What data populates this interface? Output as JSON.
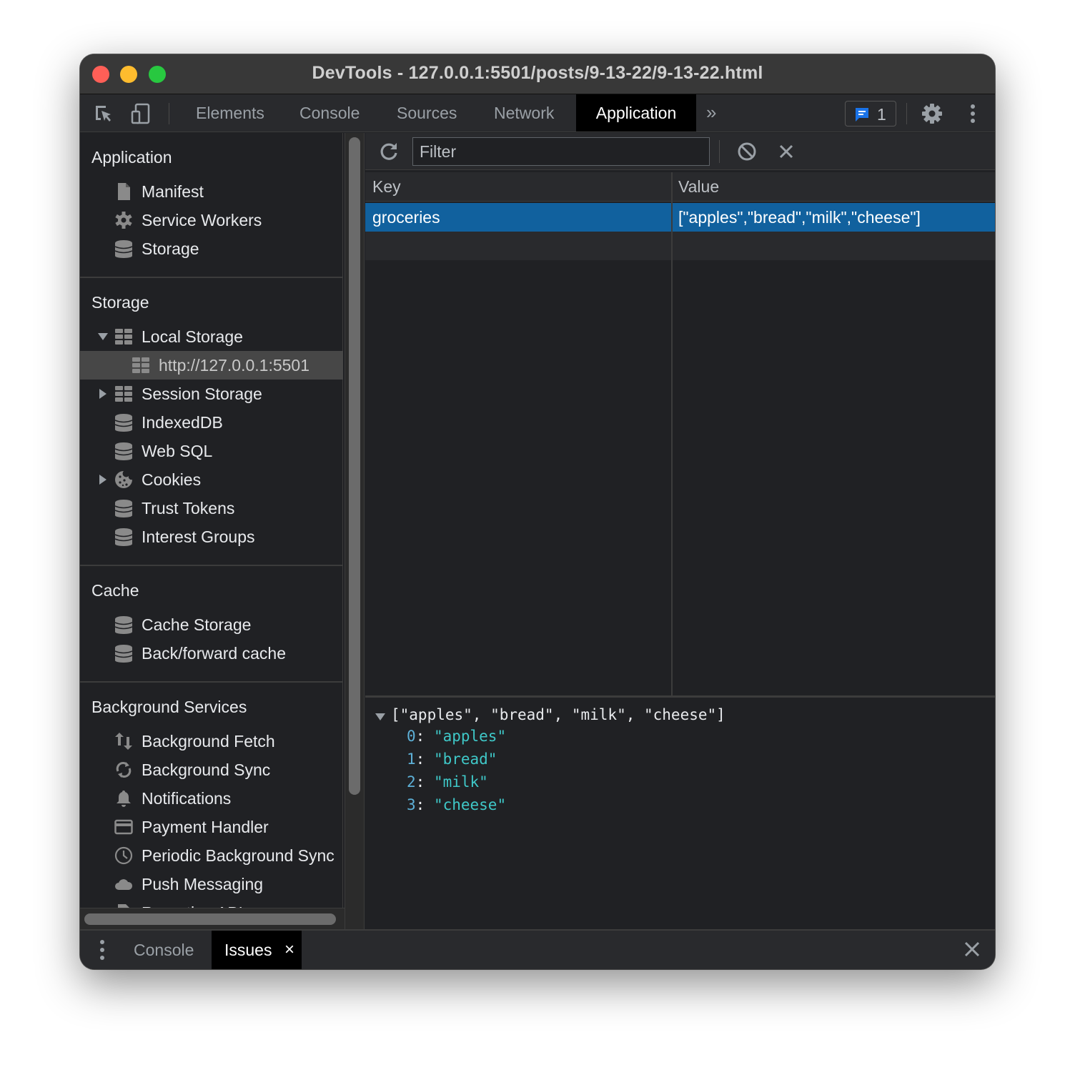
{
  "window": {
    "title": "DevTools - 127.0.0.1:5501/posts/9-13-22/9-13-22.html"
  },
  "tabbar": {
    "tabs": [
      {
        "label": "Elements",
        "active": false
      },
      {
        "label": "Console",
        "active": false
      },
      {
        "label": "Sources",
        "active": false
      },
      {
        "label": "Network",
        "active": false
      },
      {
        "label": "Application",
        "active": true
      }
    ],
    "more_tabs_glyph": "»",
    "issues_count": "1",
    "accent_color": "#1a73e8"
  },
  "sidebar": {
    "sections": [
      {
        "title": "Application",
        "items": [
          {
            "label": "Manifest",
            "icon": "document-icon"
          },
          {
            "label": "Service Workers",
            "icon": "gear-icon"
          },
          {
            "label": "Storage",
            "icon": "database-icon"
          }
        ]
      },
      {
        "title": "Storage",
        "items": [
          {
            "label": "Local Storage",
            "icon": "table-icon",
            "expanded": true
          },
          {
            "label": "http://127.0.0.1:5501",
            "icon": "table-icon",
            "selected": true
          },
          {
            "label": "Session Storage",
            "icon": "table-icon",
            "expanded": false
          },
          {
            "label": "IndexedDB",
            "icon": "database-icon"
          },
          {
            "label": "Web SQL",
            "icon": "database-icon"
          },
          {
            "label": "Cookies",
            "icon": "cookie-icon",
            "expanded": false
          },
          {
            "label": "Trust Tokens",
            "icon": "database-icon"
          },
          {
            "label": "Interest Groups",
            "icon": "database-icon"
          }
        ]
      },
      {
        "title": "Cache",
        "items": [
          {
            "label": "Cache Storage",
            "icon": "database-icon"
          },
          {
            "label": "Back/forward cache",
            "icon": "database-icon"
          }
        ]
      },
      {
        "title": "Background Services",
        "items": [
          {
            "label": "Background Fetch",
            "icon": "up-down-arrows-icon"
          },
          {
            "label": "Background Sync",
            "icon": "sync-icon"
          },
          {
            "label": "Notifications",
            "icon": "bell-icon"
          },
          {
            "label": "Payment Handler",
            "icon": "credit-card-icon"
          },
          {
            "label": "Periodic Background Sync",
            "icon": "clock-icon"
          },
          {
            "label": "Push Messaging",
            "icon": "cloud-icon"
          },
          {
            "label": "Reporting API",
            "icon": "document-icon"
          }
        ]
      }
    ]
  },
  "storage_view": {
    "filter_placeholder": "Filter",
    "filter_value": "",
    "columns": [
      "Key",
      "Value"
    ],
    "rows": [
      {
        "key": "groceries",
        "value": "[\"apples\",\"bread\",\"milk\",\"cheese\"]",
        "selected": true
      }
    ],
    "preview": {
      "summary": "[\"apples\", \"bread\", \"milk\", \"cheese\"]",
      "entries": [
        {
          "index": "0",
          "value": "\"apples\""
        },
        {
          "index": "1",
          "value": "\"bread\""
        },
        {
          "index": "2",
          "value": "\"milk\""
        },
        {
          "index": "3",
          "value": "\"cheese\""
        }
      ]
    }
  },
  "drawer": {
    "tabs": [
      {
        "label": "Console",
        "active": false
      },
      {
        "label": "Issues",
        "active": true,
        "closable": true
      }
    ],
    "close_glyph": "×"
  }
}
